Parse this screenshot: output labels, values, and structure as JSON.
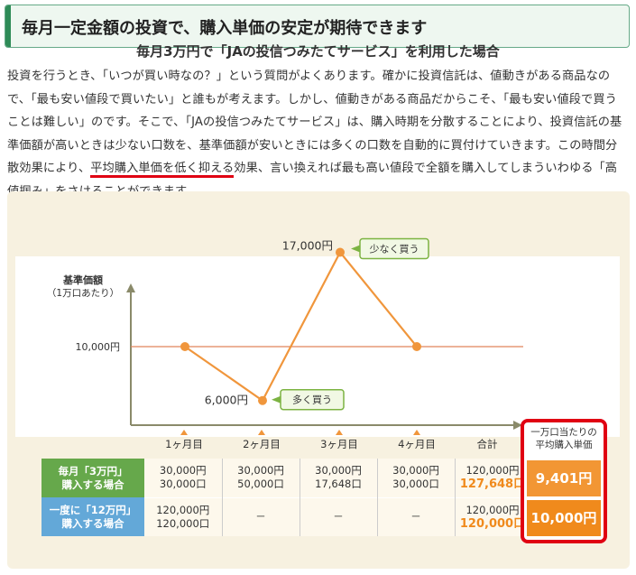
{
  "headline": "毎月一定金額の投資で、購入単価の安定が期待できます",
  "body": {
    "before": "投資を行うとき、「いつが買い時なの？」という質問がよくあります。確かに投資信託は、値動きがある商品なので、「最も安い値段で買いたい」と誰もが考えます。しかし、値動きがある商品だからこそ、「最も安い値段で買うことは難しい」のです。そこで、「JAの投信つみたてサービス」は、購入時期を分散することにより、投資信託の基準価額が高いときは少ない口数を、基準価額が安いときには多くの口数を自動的に買付けていきます。この時間分散効果により、",
    "emphasis": "平均購入単価を低く抑える",
    "after": "効果、言い換えれば最も高い値段で全額を購入してしまういわゆる「高値掴み」をさけることができます。"
  },
  "panel_title": "毎月3万円で「JAの投信つみたてサービス」を利用した場合",
  "chart_data": {
    "type": "line",
    "ylabel": "基準価額",
    "ylabel_sub": "（1万口あたり）",
    "categories": [
      "1ヶ月目",
      "2ヶ月目",
      "3ヶ月目",
      "4ヶ月目"
    ],
    "values": [
      10000,
      6000,
      17000,
      10000
    ],
    "reference_line": {
      "value": 10000,
      "label": "10,000円"
    },
    "point_labels": [
      {
        "index": 1,
        "text": "6,000円"
      },
      {
        "index": 2,
        "text": "17,000円"
      }
    ],
    "callouts": [
      {
        "index": 1,
        "text": "多く買う"
      },
      {
        "index": 2,
        "text": "少なく買う"
      }
    ],
    "colors": {
      "line": "#f0963c",
      "reference": "#e0855a",
      "axis": "#8a8a6a",
      "callout_border": "#7cb342",
      "callout_bg": "#f1f8e4"
    }
  },
  "table": {
    "total_label": "合計",
    "rows": [
      {
        "label_line1": "毎月「3万円」",
        "label_line2": "購入する場合",
        "cells": [
          [
            "30,000円",
            "30,000口"
          ],
          [
            "30,000円",
            "50,000口"
          ],
          [
            "30,000円",
            "17,648口"
          ],
          [
            "30,000円",
            "30,000口"
          ]
        ],
        "total": [
          "120,000円",
          "127,648口"
        ]
      },
      {
        "label_line1": "一度に「12万円」",
        "label_line2": "購入する場合",
        "cells": [
          [
            "120,000円",
            "120,000口"
          ],
          [
            "－",
            ""
          ],
          [
            "－",
            ""
          ],
          [
            "－",
            ""
          ]
        ],
        "total": [
          "120,000円",
          "120,000口"
        ]
      }
    ]
  },
  "highlight": {
    "head_line1": "一万口当たりの",
    "head_line2": "平均購入単価",
    "value1": "9,401円",
    "value2": "10,000円"
  }
}
